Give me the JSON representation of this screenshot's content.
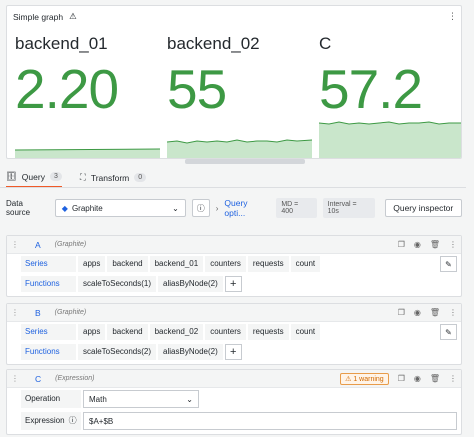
{
  "panel": {
    "title": "Simple graph",
    "menu_glyph": "⋮",
    "stats": [
      {
        "name": "backend_01",
        "value": "2.20",
        "color": "#3d9944"
      },
      {
        "name": "backend_02",
        "value": "55",
        "color": "#3d9944"
      },
      {
        "name": "C",
        "value": "57.2",
        "color": "#3d9944"
      }
    ]
  },
  "tabs": [
    {
      "label": "Query",
      "count": "3",
      "icon": "database-icon"
    },
    {
      "label": "Transform",
      "count": "0",
      "icon": "transform-icon"
    }
  ],
  "datasource": {
    "label": "Data source",
    "name": "Graphite",
    "query_options": "Query opti...",
    "md": "MD = 400",
    "interval": "Interval = 10s",
    "inspector": "Query inspector"
  },
  "queries": [
    {
      "letter": "A",
      "source": "(Graphite)",
      "series_label": "Series",
      "series": [
        "apps",
        "backend",
        "backend_01",
        "counters",
        "requests",
        "count"
      ],
      "functions_label": "Functions",
      "functions": [
        "scaleToSeconds(1)",
        "aliasByNode(2)"
      ]
    },
    {
      "letter": "B",
      "source": "(Graphite)",
      "series_label": "Series",
      "series": [
        "apps",
        "backend",
        "backend_02",
        "counters",
        "requests",
        "count"
      ],
      "functions_label": "Functions",
      "functions": [
        "scaleToSeconds(2)",
        "aliasByNode(2)"
      ]
    }
  ],
  "expression": {
    "letter": "C",
    "source": "(Expression)",
    "warning": "1 warning",
    "operation_label": "Operation",
    "operation_value": "Math",
    "expression_label": "Expression",
    "expression_value": "$A+$B"
  }
}
